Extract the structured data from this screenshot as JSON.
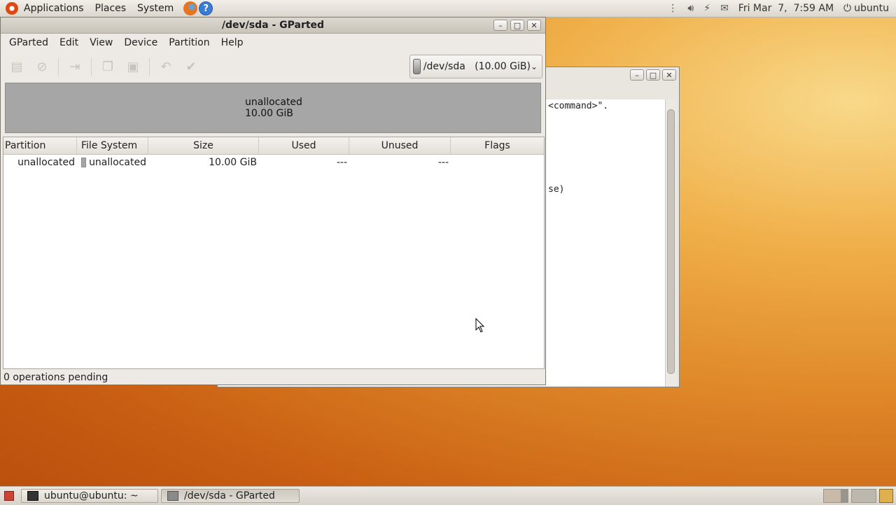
{
  "top_panel": {
    "menus": [
      "Applications",
      "Places",
      "System"
    ],
    "clock": "Fri Mar  7,  7:59 AM",
    "user": "ubuntu"
  },
  "terminal": {
    "lines": [
      "<command>\".",
      "se)"
    ]
  },
  "gparted": {
    "title": "/dev/sda - GParted",
    "menus": [
      "GParted",
      "Edit",
      "View",
      "Device",
      "Partition",
      "Help"
    ],
    "device": "/dev/sda   (10.00 GiB)",
    "disk_map": {
      "label": "unallocated",
      "size": "10.00 GiB"
    },
    "columns": [
      "Partition",
      "File System",
      "Size",
      "Used",
      "Unused",
      "Flags"
    ],
    "rows": [
      {
        "partition": "unallocated",
        "filesystem": "unallocated",
        "size": "10.00 GiB",
        "used": "---",
        "unused": "---",
        "flags": ""
      }
    ],
    "status": "0 operations pending"
  },
  "taskbar": {
    "tasks": [
      "ubuntu@ubuntu: ~",
      "/dev/sda - GParted"
    ]
  },
  "colors": {
    "unallocated": "#a6a6a6",
    "desktop_accent": "#e08a2a"
  }
}
